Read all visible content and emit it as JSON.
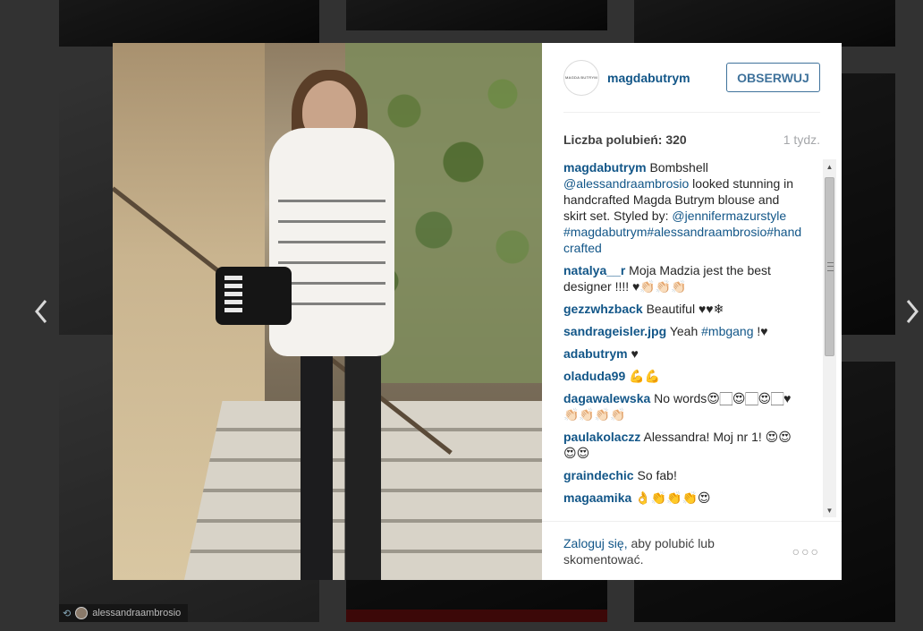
{
  "background": {
    "repost_user": "alessandraambrosio"
  },
  "post": {
    "username": "magdabutrym",
    "avatar_text": "MAGDA BUTRYM",
    "follow_label": "OBSERWUJ",
    "likes": "Liczba polubień: 320",
    "time": "1 tydz."
  },
  "caption": {
    "user": "magdabutrym",
    "text_1": "Bombshell",
    "mention": "@alessandraambrosio",
    "text_2": "looked stunning in handcrafted Magda Butrym blouse and skirt set. Styled by:",
    "stylist": "@jennifermazurstyle",
    "tags": "#magdabutrym#alessandraambrosio#handcrafted"
  },
  "comments": [
    {
      "user": "natalya__r",
      "text": "Moja Madzia jest the best designer !!!! ♥👏🏻👏🏻👏🏻"
    },
    {
      "user": "gezzwhzback",
      "text": "Beautiful ♥♥❄"
    },
    {
      "user": "sandrageisler.jpg",
      "text": "Yeah",
      "tag": "#mbgang",
      "after": "!♥"
    },
    {
      "user": "adabutrym",
      "text": "♥"
    },
    {
      "user": "oladuda99",
      "text": "💪💪"
    },
    {
      "user": "dagawalewska",
      "text": "No words😍🏻😍🏻😍🏻♥👏🏻👏🏻👏🏻👏🏻"
    },
    {
      "user": "paulakolaczz",
      "text": "Alessandra! Moj nr 1! 😍😍😍😍"
    },
    {
      "user": "graindechic",
      "text": "So fab!"
    },
    {
      "user": "magaamika",
      "text": "👌👏👏👏😍"
    }
  ],
  "footer": {
    "login_link": "Zaloguj się,",
    "login_rest": "aby polubić lub skomentować.",
    "more_label": "○○○"
  }
}
